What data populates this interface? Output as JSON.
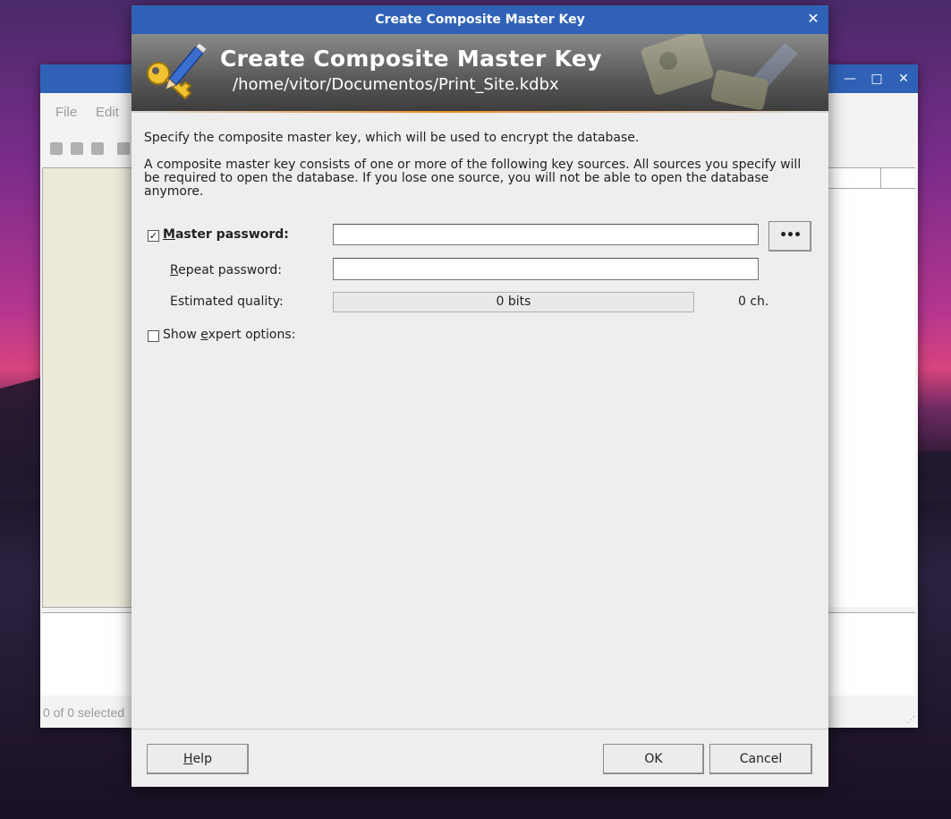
{
  "main_window": {
    "menu": [
      "File",
      "Edit"
    ],
    "status": "0 of 0 selected",
    "controls": {
      "minimize": "—",
      "maximize": "□",
      "close": "✕"
    }
  },
  "dialog": {
    "window_title": "Create Composite Master Key",
    "close_glyph": "✕",
    "banner": {
      "title": "Create Composite Master Key",
      "subtitle": "/home/vitor/Documentos/Print_Site.kdbx",
      "icon": "key-pencil-icon"
    },
    "intro": "Specify the composite master key, which will be used to encrypt the database.",
    "description": "A composite master key consists of one or more of the following key sources. All sources you specify will be required to open the database. If you lose one source, you will not be able to open the database anymore.",
    "master_password": {
      "checked": true,
      "check_glyph": "✓",
      "label_mnemonic": "M",
      "label_rest": "aster password:",
      "value": "",
      "reveal_button": "•••"
    },
    "repeat_password": {
      "label_mnemonic": "R",
      "label_rest": "epeat password:",
      "value": ""
    },
    "quality": {
      "label": "Estimated quality:",
      "bits": "0 bits",
      "chars": "0 ch.",
      "level": 0
    },
    "expert": {
      "checked": false,
      "label_pre": "Show ",
      "label_mnemonic": "e",
      "label_rest": "xpert options:"
    },
    "buttons": {
      "help_mnemonic": "H",
      "help_rest": "elp",
      "ok": "OK",
      "cancel": "Cancel"
    }
  }
}
